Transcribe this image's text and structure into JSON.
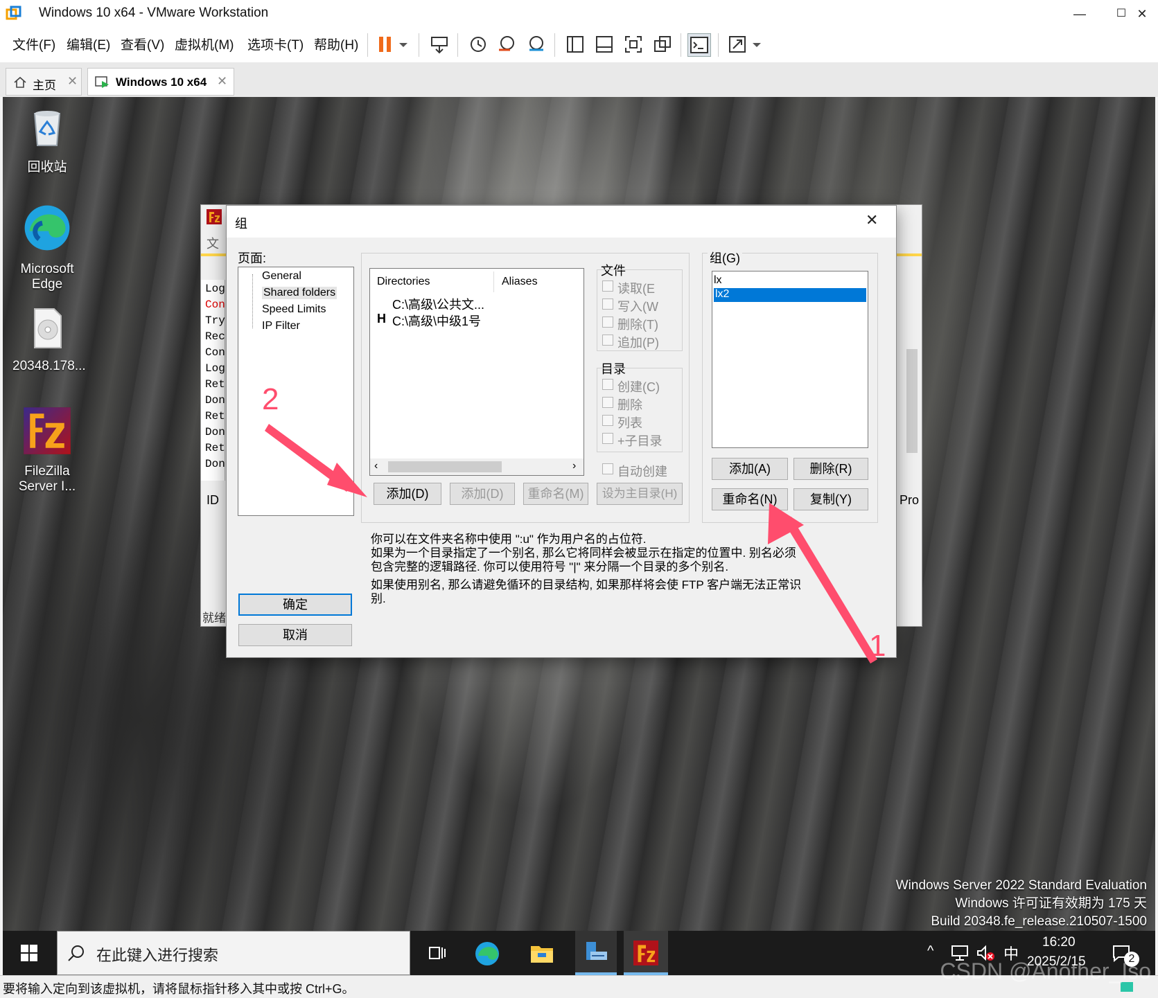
{
  "app": {
    "title": "Windows 10 x64 - VMware Workstation",
    "minimize": "—",
    "maximize": "☐",
    "close": "✕"
  },
  "menu": {
    "items": [
      "文件(F)",
      "编辑(E)",
      "查看(V)",
      "虚拟机(M)",
      "选项卡(T)",
      "帮助(H)"
    ]
  },
  "tabs": [
    {
      "label": "主页"
    },
    {
      "label": "Windows 10 x64"
    }
  ],
  "desktop": {
    "icons": [
      {
        "label": "回收站"
      },
      {
        "label": "Microsoft Edge"
      },
      {
        "label": "20348.178..."
      },
      {
        "label": "FileZilla Server I..."
      }
    ]
  },
  "fz_back": {
    "menu_partial": "文",
    "log_lines": [
      "Log",
      "Con",
      "Try",
      "Rec",
      "Con",
      "Log",
      "Ret",
      "Don",
      "Ret",
      "Don",
      "Ret",
      "Don"
    ],
    "id_label": "ID",
    "pro_label": "Pro",
    "status_partial": "就绪"
  },
  "dialog": {
    "title": "组",
    "pages_label": "页面:",
    "pages": [
      "General",
      "Shared folders",
      "Speed Limits",
      "IP Filter"
    ],
    "dir_columns": [
      "Directories",
      "Aliases"
    ],
    "dirs": [
      {
        "flag": "",
        "path": "C:\\高级\\公共文..."
      },
      {
        "flag": "H",
        "path": "C:\\高级\\中级1号"
      }
    ],
    "file_group": "文件",
    "file_perms": [
      "读取(E",
      "写入(W",
      "删除(T)",
      "追加(P)"
    ],
    "dir_group": "目录",
    "dir_perms": [
      "创建(C)",
      "删除",
      "列表",
      "+子目录"
    ],
    "auto_create": "自动创建",
    "dir_buttons": [
      "添加(D)",
      "添加(D)",
      "重命名(M)",
      "设为主目录(H)"
    ],
    "groups_label": "组(G)",
    "groups": [
      "lx",
      "lx2"
    ],
    "group_buttons": [
      "添加(A)",
      "删除(R)",
      "重命名(N)",
      "复制(Y)"
    ],
    "help_lines": [
      "你可以在文件夹名称中使用 \":u\" 作为用户名的占位符.",
      "如果为一个目录指定了一个别名, 那么它将同样会被显示在指定的位置中. 别名必须",
      "包含完整的逻辑路径. 你可以使用符号 \"|\" 来分隔一个目录的多个别名.",
      "如果使用别名, 那么请避免循环的目录结构, 如果那样将会使 FTP 客户端无法正常识",
      "别."
    ],
    "ok": "确定",
    "cancel": "取消",
    "close": "✕"
  },
  "annotations": {
    "one": "1",
    "two": "2",
    "color": "#ff4d6d"
  },
  "license": {
    "lines": [
      "Windows Server 2022 Standard Evaluation",
      "Windows 许可证有效期为 175 天",
      "Build 20348.fe_release.210507-1500"
    ]
  },
  "taskbar": {
    "search_placeholder": "在此键入进行搜索",
    "time": "16:20",
    "date": "2025/2/15",
    "ime": "中",
    "notif_count": "2"
  },
  "statusbar": {
    "text": "要将输入定向到该虚拟机，请将鼠标指针移入其中或按 Ctrl+G。"
  },
  "watermark": "CSDN @Another_Iso"
}
